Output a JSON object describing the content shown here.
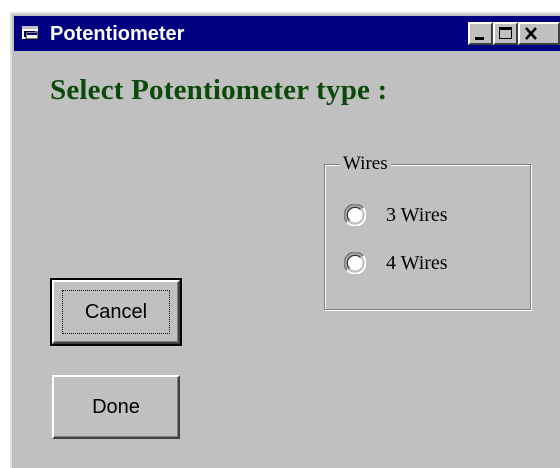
{
  "window": {
    "title": "Potentiometer",
    "controls": [
      "minimize",
      "maximize",
      "close"
    ]
  },
  "heading": "Select Potentiometer type :",
  "wires_group": {
    "legend": "Wires",
    "options": [
      {
        "label": "3 Wires",
        "selected": false
      },
      {
        "label": "4 Wires",
        "selected": false
      }
    ]
  },
  "buttons": {
    "cancel": "Cancel",
    "done": "Done"
  },
  "colors": {
    "titlebar": "#000080",
    "face": "#c0c0c0",
    "heading": "#0b4a0b"
  },
  "icons": {
    "app": "app-window-icon",
    "minimize": "minimize-icon",
    "maximize": "maximize-icon",
    "close": "close-icon"
  }
}
